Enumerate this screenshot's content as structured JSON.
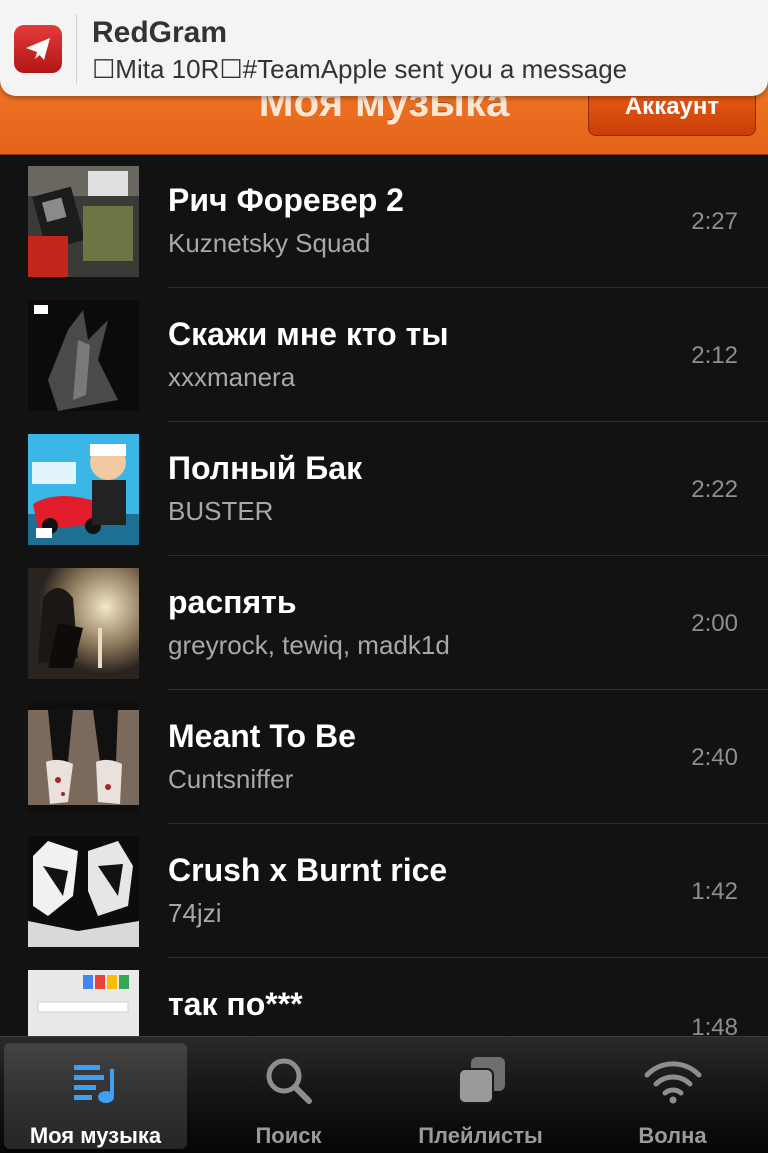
{
  "notification": {
    "app": "RedGram",
    "message": "☐Mita 10R☐#TeamApple sent you a message"
  },
  "header": {
    "title": "Моя музыка",
    "account_label": "Аккаунт"
  },
  "tracks": [
    {
      "title": "Рич Форевер 2",
      "artist": "Kuznetsky Squad",
      "duration": "2:27"
    },
    {
      "title": "Скажи мне кто ты",
      "artist": "xxxmanera",
      "duration": "2:12"
    },
    {
      "title": "Полный Бак",
      "artist": "BUSTER",
      "duration": "2:22"
    },
    {
      "title": "распять",
      "artist": "greyrock, tewiq, madk1d",
      "duration": "2:00"
    },
    {
      "title": "Meant To Be",
      "artist": "Cuntsniffer",
      "duration": "2:40"
    },
    {
      "title": "Crush x Burnt rice",
      "artist": "74jzi",
      "duration": "1:42"
    },
    {
      "title": "так по***",
      "artist": "",
      "duration": "1:48"
    }
  ],
  "tabs": [
    {
      "label": "Моя музыка",
      "icon": "music-list-icon",
      "active": true
    },
    {
      "label": "Поиск",
      "icon": "search-icon",
      "active": false
    },
    {
      "label": "Плейлисты",
      "icon": "playlists-icon",
      "active": false
    },
    {
      "label": "Волна",
      "icon": "wave-icon",
      "active": false
    }
  ],
  "colors": {
    "accent": "#ee7424",
    "background": "#121212",
    "active_tab_icon": "#3ea0f5"
  }
}
